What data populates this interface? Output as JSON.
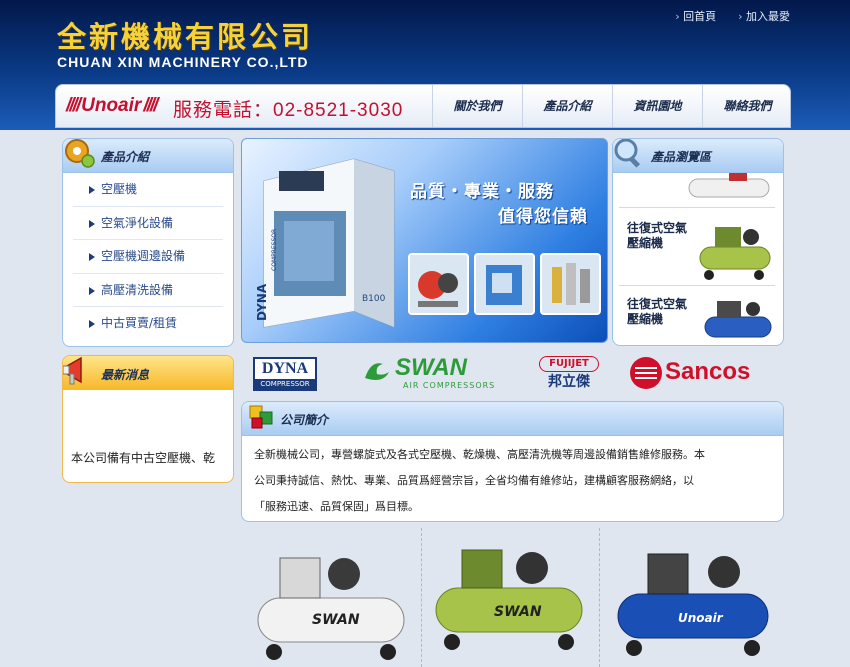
{
  "header": {
    "company_cn": "全新機械有限公司",
    "company_en": "CHUAN XIN MACHINERY CO.,LTD",
    "top_links": [
      "回首頁",
      "加入最愛"
    ]
  },
  "navbar": {
    "brand": "Unoair",
    "phone": "服務電話：02-8521-3030",
    "items": [
      "關於我們",
      "產品介紹",
      "資訊園地",
      "聯絡我們"
    ]
  },
  "products_menu": {
    "title": "產品介紹",
    "items": [
      "空壓機",
      "空氣淨化設備",
      "空壓機週邊設備",
      "高壓清洗設備",
      "中古買賣/租賃"
    ]
  },
  "news": {
    "title": "最新消息",
    "text": "本公司備有中古空壓機、乾"
  },
  "banner": {
    "tagline1": "品質・專業・服務",
    "tagline2": "值得您信賴",
    "machine_brand": "DYNA",
    "machine_sub": "COMPRESSOR",
    "machine_model": "B100"
  },
  "browse": {
    "title": "產品瀏覽區",
    "cards": [
      {
        "label": "往復式空氣壓縮機"
      },
      {
        "label": "往復式空氣壓縮機"
      }
    ]
  },
  "brands": {
    "dyna": "DYNA",
    "dyna_sub": "COMPRESSOR",
    "swan": "SWAN",
    "swan_sub": "AIR COMPRESSORS",
    "fujet": "FUJIJET",
    "fujet_cn": "邦立傑",
    "sancos": "Sancos"
  },
  "intro": {
    "title": "公司簡介",
    "lines": [
      "全新機械公司，專營螺旋式及各式空壓機、乾燥機、高壓清洗機等周邊設備銷售維修服務。本",
      "公司秉持誠信、熱忱、專業、品質爲經營宗旨，全省均備有維修站，建構顧客服務網絡，以",
      "「服務迅速、品質保固」爲目標。"
    ]
  },
  "bottom_products": [
    {
      "brand": "SWAN",
      "color": "#f2f2f2"
    },
    {
      "brand": "SWAN",
      "color": "#a8c34a"
    },
    {
      "brand": "Unoair",
      "color": "#1a4fb5"
    }
  ],
  "colors": {
    "accent": "#c4102e",
    "nav_dark": "#0a3a86",
    "gold": "#f5d23a"
  }
}
